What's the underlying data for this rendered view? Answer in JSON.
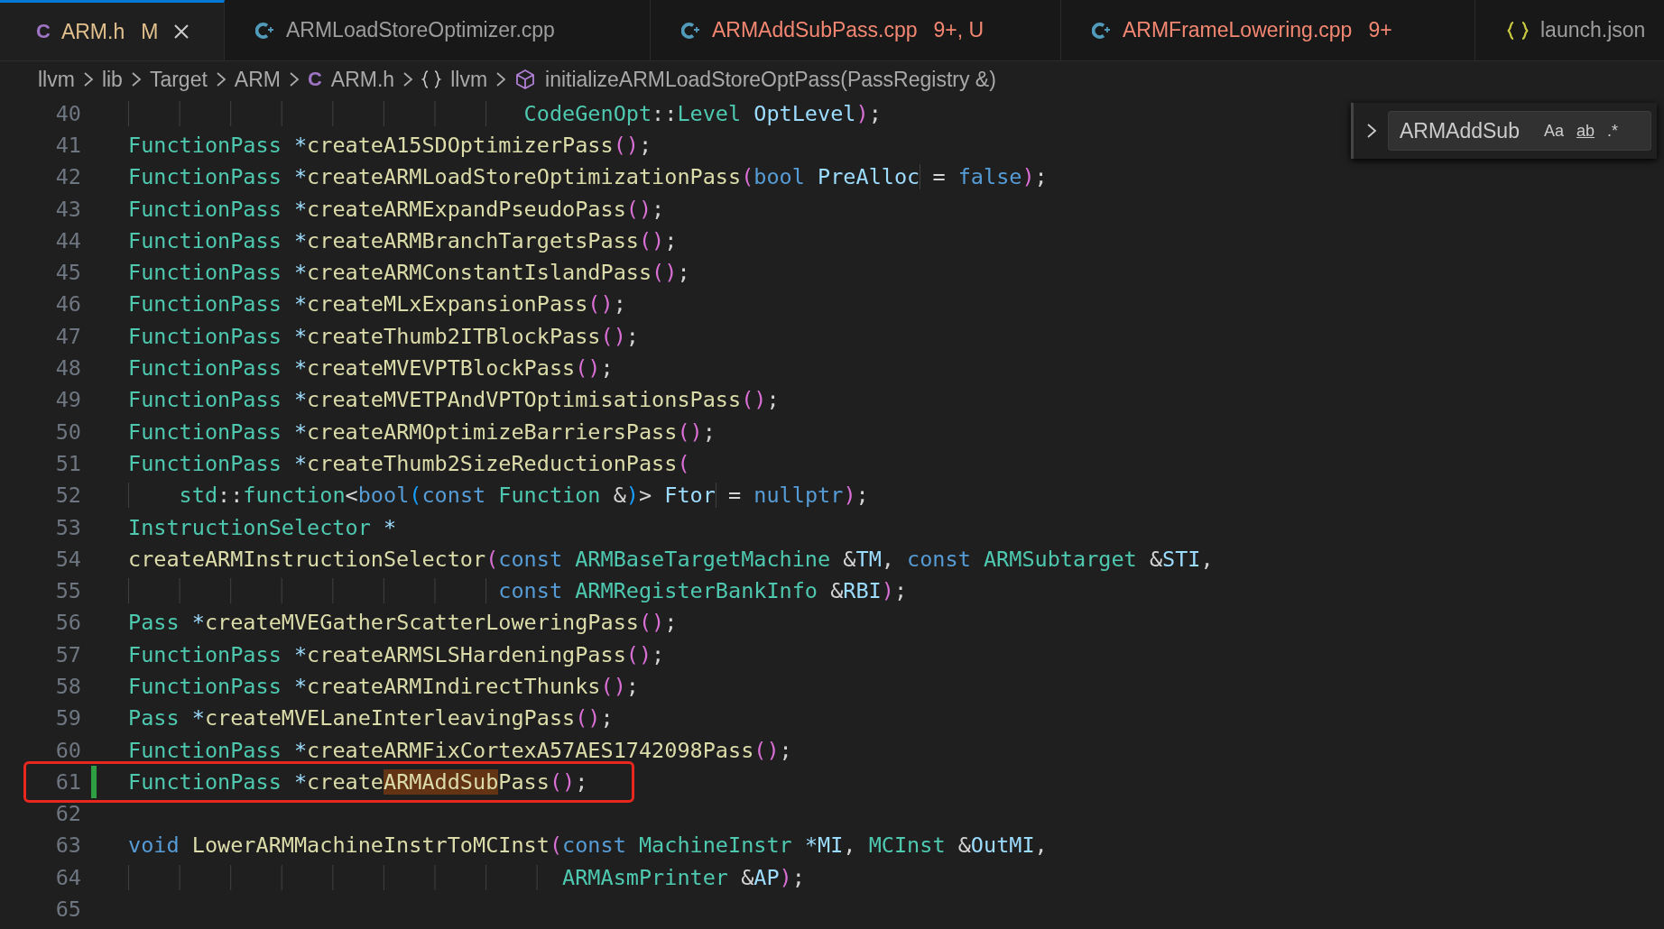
{
  "tabs": [
    {
      "label": "ARM.h",
      "kind": "c",
      "glyph": "C",
      "color": "#e2c08d",
      "badge": "M",
      "selected": true,
      "closable": true
    },
    {
      "label": "ARMLoadStoreOptimizer.cpp",
      "kind": "cpp",
      "color": "#9d9d9d",
      "selected": false,
      "closable": false
    },
    {
      "label": "ARMAddSubPass.cpp",
      "kind": "cpp",
      "color": "#f48771",
      "badge": "9+, U",
      "selected": false,
      "closable": false
    },
    {
      "label": "ARMFrameLowering.cpp",
      "kind": "cpp",
      "color": "#f48771",
      "badge": "9+",
      "selected": false,
      "closable": false
    },
    {
      "label": "launch.json",
      "kind": "json",
      "color": "#9d9d9d",
      "selected": false,
      "closable": false
    }
  ],
  "breadcrumb": [
    {
      "label": "llvm",
      "kind": "folder"
    },
    {
      "label": "lib",
      "kind": "folder"
    },
    {
      "label": "Target",
      "kind": "folder"
    },
    {
      "label": "ARM",
      "kind": "folder"
    },
    {
      "label": "ARM.h",
      "kind": "c",
      "glyph": "C"
    },
    {
      "label": "llvm",
      "kind": "namespace"
    },
    {
      "label": "initializeARMLoadStoreOptPass(PassRegistry &)",
      "kind": "function"
    }
  ],
  "find": {
    "expanded": false,
    "value": "ARMAddSub",
    "options": [
      {
        "label": "Aa",
        "on": false
      },
      {
        "label": "ab",
        "on": false
      },
      {
        "label": ".*",
        "on": false
      }
    ]
  },
  "lines": [
    {
      "number": "40",
      "modified": false,
      "boxed": false,
      "tokens": [
        {
          "kind": "type",
          "text": "                               CodeGenOpt"
        },
        {
          "kind": "plain",
          "text": "::"
        },
        {
          "kind": "type",
          "text": "Level "
        },
        {
          "kind": "var",
          "text": "OptLevel"
        },
        {
          "kind": "paren",
          "text": ")"
        },
        {
          "kind": "plain",
          "text": ";"
        }
      ]
    },
    {
      "number": "41",
      "modified": false,
      "boxed": false,
      "tokens": [
        {
          "kind": "type",
          "text": "FunctionPass "
        },
        {
          "kind": "op",
          "text": "*"
        },
        {
          "kind": "func",
          "text": "createA15SDOptimizerPass"
        },
        {
          "kind": "paren",
          "text": "()"
        },
        {
          "kind": "plain",
          "text": ";"
        }
      ]
    },
    {
      "number": "42",
      "modified": false,
      "boxed": false,
      "tokens": [
        {
          "kind": "type",
          "text": "FunctionPass "
        },
        {
          "kind": "op",
          "text": "*"
        },
        {
          "kind": "func",
          "text": "createARMLoadStoreOptimizationPass"
        },
        {
          "kind": "paren",
          "text": "("
        },
        {
          "kind": "kw",
          "text": "bool "
        },
        {
          "kind": "var",
          "text": "PreAlloc"
        },
        {
          "kind": "plain",
          "text": " = "
        },
        {
          "kind": "kw",
          "text": "false"
        },
        {
          "kind": "paren",
          "text": ")"
        },
        {
          "kind": "plain",
          "text": ";"
        }
      ]
    },
    {
      "number": "43",
      "modified": false,
      "boxed": false,
      "tokens": [
        {
          "kind": "type",
          "text": "FunctionPass "
        },
        {
          "kind": "op",
          "text": "*"
        },
        {
          "kind": "func",
          "text": "createARMExpandPseudoPass"
        },
        {
          "kind": "paren",
          "text": "()"
        },
        {
          "kind": "plain",
          "text": ";"
        }
      ]
    },
    {
      "number": "44",
      "modified": false,
      "boxed": false,
      "tokens": [
        {
          "kind": "type",
          "text": "FunctionPass "
        },
        {
          "kind": "op",
          "text": "*"
        },
        {
          "kind": "func",
          "text": "createARMBranchTargetsPass"
        },
        {
          "kind": "paren",
          "text": "()"
        },
        {
          "kind": "plain",
          "text": ";"
        }
      ]
    },
    {
      "number": "45",
      "modified": false,
      "boxed": false,
      "tokens": [
        {
          "kind": "type",
          "text": "FunctionPass "
        },
        {
          "kind": "op",
          "text": "*"
        },
        {
          "kind": "func",
          "text": "createARMConstantIslandPass"
        },
        {
          "kind": "paren",
          "text": "()"
        },
        {
          "kind": "plain",
          "text": ";"
        }
      ]
    },
    {
      "number": "46",
      "modified": false,
      "boxed": false,
      "tokens": [
        {
          "kind": "type",
          "text": "FunctionPass "
        },
        {
          "kind": "op",
          "text": "*"
        },
        {
          "kind": "func",
          "text": "createMLxExpansionPass"
        },
        {
          "kind": "paren",
          "text": "()"
        },
        {
          "kind": "plain",
          "text": ";"
        }
      ]
    },
    {
      "number": "47",
      "modified": false,
      "boxed": false,
      "tokens": [
        {
          "kind": "type",
          "text": "FunctionPass "
        },
        {
          "kind": "op",
          "text": "*"
        },
        {
          "kind": "func",
          "text": "createThumb2ITBlockPass"
        },
        {
          "kind": "paren",
          "text": "()"
        },
        {
          "kind": "plain",
          "text": ";"
        }
      ]
    },
    {
      "number": "48",
      "modified": false,
      "boxed": false,
      "tokens": [
        {
          "kind": "type",
          "text": "FunctionPass "
        },
        {
          "kind": "op",
          "text": "*"
        },
        {
          "kind": "func",
          "text": "createMVEVPTBlockPass"
        },
        {
          "kind": "paren",
          "text": "()"
        },
        {
          "kind": "plain",
          "text": ";"
        }
      ]
    },
    {
      "number": "49",
      "modified": false,
      "boxed": false,
      "tokens": [
        {
          "kind": "type",
          "text": "FunctionPass "
        },
        {
          "kind": "op",
          "text": "*"
        },
        {
          "kind": "func",
          "text": "createMVETPAndVPTOptimisationsPass"
        },
        {
          "kind": "paren",
          "text": "()"
        },
        {
          "kind": "plain",
          "text": ";"
        }
      ]
    },
    {
      "number": "50",
      "modified": false,
      "boxed": false,
      "tokens": [
        {
          "kind": "type",
          "text": "FunctionPass "
        },
        {
          "kind": "op",
          "text": "*"
        },
        {
          "kind": "func",
          "text": "createARMOptimizeBarriersPass"
        },
        {
          "kind": "paren",
          "text": "()"
        },
        {
          "kind": "plain",
          "text": ";"
        }
      ]
    },
    {
      "number": "51",
      "modified": false,
      "boxed": false,
      "tokens": [
        {
          "kind": "type",
          "text": "FunctionPass "
        },
        {
          "kind": "op",
          "text": "*"
        },
        {
          "kind": "func",
          "text": "createThumb2SizeReductionPass"
        },
        {
          "kind": "paren",
          "text": "("
        }
      ]
    },
    {
      "number": "52",
      "modified": false,
      "boxed": false,
      "tokens": [
        {
          "kind": "type",
          "text": "    std"
        },
        {
          "kind": "plain",
          "text": "::"
        },
        {
          "kind": "type",
          "text": "function"
        },
        {
          "kind": "plain",
          "text": "<"
        },
        {
          "kind": "kw",
          "text": "bool"
        },
        {
          "kind": "paren2",
          "text": "("
        },
        {
          "kind": "kw",
          "text": "const "
        },
        {
          "kind": "type",
          "text": "Function "
        },
        {
          "kind": "plain",
          "text": "&"
        },
        {
          "kind": "paren2",
          "text": ")"
        },
        {
          "kind": "plain",
          "text": "> "
        },
        {
          "kind": "var",
          "text": "Ftor"
        },
        {
          "kind": "plain",
          "text": " = "
        },
        {
          "kind": "kw",
          "text": "nullptr"
        },
        {
          "kind": "paren",
          "text": ")"
        },
        {
          "kind": "plain",
          "text": ";"
        }
      ]
    },
    {
      "number": "53",
      "modified": false,
      "boxed": false,
      "tokens": [
        {
          "kind": "type",
          "text": "InstructionSelector "
        },
        {
          "kind": "op",
          "text": "*"
        }
      ]
    },
    {
      "number": "54",
      "modified": false,
      "boxed": false,
      "tokens": [
        {
          "kind": "func",
          "text": "createARMInstructionSelector"
        },
        {
          "kind": "paren",
          "text": "("
        },
        {
          "kind": "kw",
          "text": "const "
        },
        {
          "kind": "type",
          "text": "ARMBaseTargetMachine "
        },
        {
          "kind": "plain",
          "text": "&"
        },
        {
          "kind": "var",
          "text": "TM"
        },
        {
          "kind": "plain",
          "text": ", "
        },
        {
          "kind": "kw",
          "text": "const "
        },
        {
          "kind": "type",
          "text": "ARMSubtarget "
        },
        {
          "kind": "plain",
          "text": "&"
        },
        {
          "kind": "var",
          "text": "STI"
        },
        {
          "kind": "plain",
          "text": ","
        }
      ]
    },
    {
      "number": "55",
      "modified": false,
      "boxed": false,
      "tokens": [
        {
          "kind": "kw",
          "text": "                             const "
        },
        {
          "kind": "type",
          "text": "ARMRegisterBankInfo "
        },
        {
          "kind": "plain",
          "text": "&"
        },
        {
          "kind": "var",
          "text": "RBI"
        },
        {
          "kind": "paren",
          "text": ")"
        },
        {
          "kind": "plain",
          "text": ";"
        }
      ]
    },
    {
      "number": "56",
      "modified": false,
      "boxed": false,
      "tokens": [
        {
          "kind": "type",
          "text": "Pass "
        },
        {
          "kind": "op",
          "text": "*"
        },
        {
          "kind": "func",
          "text": "createMVEGatherScatterLoweringPass"
        },
        {
          "kind": "paren",
          "text": "()"
        },
        {
          "kind": "plain",
          "text": ";"
        }
      ]
    },
    {
      "number": "57",
      "modified": false,
      "boxed": false,
      "tokens": [
        {
          "kind": "type",
          "text": "FunctionPass "
        },
        {
          "kind": "op",
          "text": "*"
        },
        {
          "kind": "func",
          "text": "createARMSLSHardeningPass"
        },
        {
          "kind": "paren",
          "text": "()"
        },
        {
          "kind": "plain",
          "text": ";"
        }
      ]
    },
    {
      "number": "58",
      "modified": false,
      "boxed": false,
      "tokens": [
        {
          "kind": "type",
          "text": "FunctionPass "
        },
        {
          "kind": "op",
          "text": "*"
        },
        {
          "kind": "func",
          "text": "createARMIndirectThunks"
        },
        {
          "kind": "paren",
          "text": "()"
        },
        {
          "kind": "plain",
          "text": ";"
        }
      ]
    },
    {
      "number": "59",
      "modified": false,
      "boxed": false,
      "tokens": [
        {
          "kind": "type",
          "text": "Pass "
        },
        {
          "kind": "op",
          "text": "*"
        },
        {
          "kind": "func",
          "text": "createMVELaneInterleavingPass"
        },
        {
          "kind": "paren",
          "text": "()"
        },
        {
          "kind": "plain",
          "text": ";"
        }
      ]
    },
    {
      "number": "60",
      "modified": false,
      "boxed": false,
      "tokens": [
        {
          "kind": "type",
          "text": "FunctionPass "
        },
        {
          "kind": "op",
          "text": "*"
        },
        {
          "kind": "func",
          "text": "createARMFixCortexA57AES1742098Pass"
        },
        {
          "kind": "paren",
          "text": "()"
        },
        {
          "kind": "plain",
          "text": ";"
        }
      ]
    },
    {
      "number": "61",
      "modified": true,
      "boxed": true,
      "tokens": [
        {
          "kind": "type",
          "text": "FunctionPass "
        },
        {
          "kind": "op",
          "text": "*"
        },
        {
          "kind": "func",
          "text": "create"
        },
        {
          "kind": "match",
          "text": "ARMAddSub"
        },
        {
          "kind": "func",
          "text": "Pass"
        },
        {
          "kind": "paren",
          "text": "()"
        },
        {
          "kind": "plain",
          "text": ";"
        }
      ]
    },
    {
      "number": "62",
      "modified": false,
      "boxed": false
    },
    {
      "number": "63",
      "modified": false,
      "boxed": false,
      "tokens": [
        {
          "kind": "kw",
          "text": "void "
        },
        {
          "kind": "func",
          "text": "LowerARMMachineInstrToMCInst"
        },
        {
          "kind": "paren",
          "text": "("
        },
        {
          "kind": "kw",
          "text": "const "
        },
        {
          "kind": "type",
          "text": "MachineInstr "
        },
        {
          "kind": "op",
          "text": "*"
        },
        {
          "kind": "var",
          "text": "MI"
        },
        {
          "kind": "plain",
          "text": ", "
        },
        {
          "kind": "type",
          "text": "MCInst "
        },
        {
          "kind": "plain",
          "text": "&"
        },
        {
          "kind": "var",
          "text": "OutMI"
        },
        {
          "kind": "plain",
          "text": ","
        }
      ]
    },
    {
      "number": "64",
      "modified": false,
      "boxed": false,
      "tokens": [
        {
          "kind": "type",
          "text": "                                  ARMAsmPrinter "
        },
        {
          "kind": "plain",
          "text": "&"
        },
        {
          "kind": "var",
          "text": "AP"
        },
        {
          "kind": "paren",
          "text": ")"
        },
        {
          "kind": "plain",
          "text": ";"
        }
      ]
    },
    {
      "number": "65",
      "modified": false,
      "boxed": false
    }
  ]
}
